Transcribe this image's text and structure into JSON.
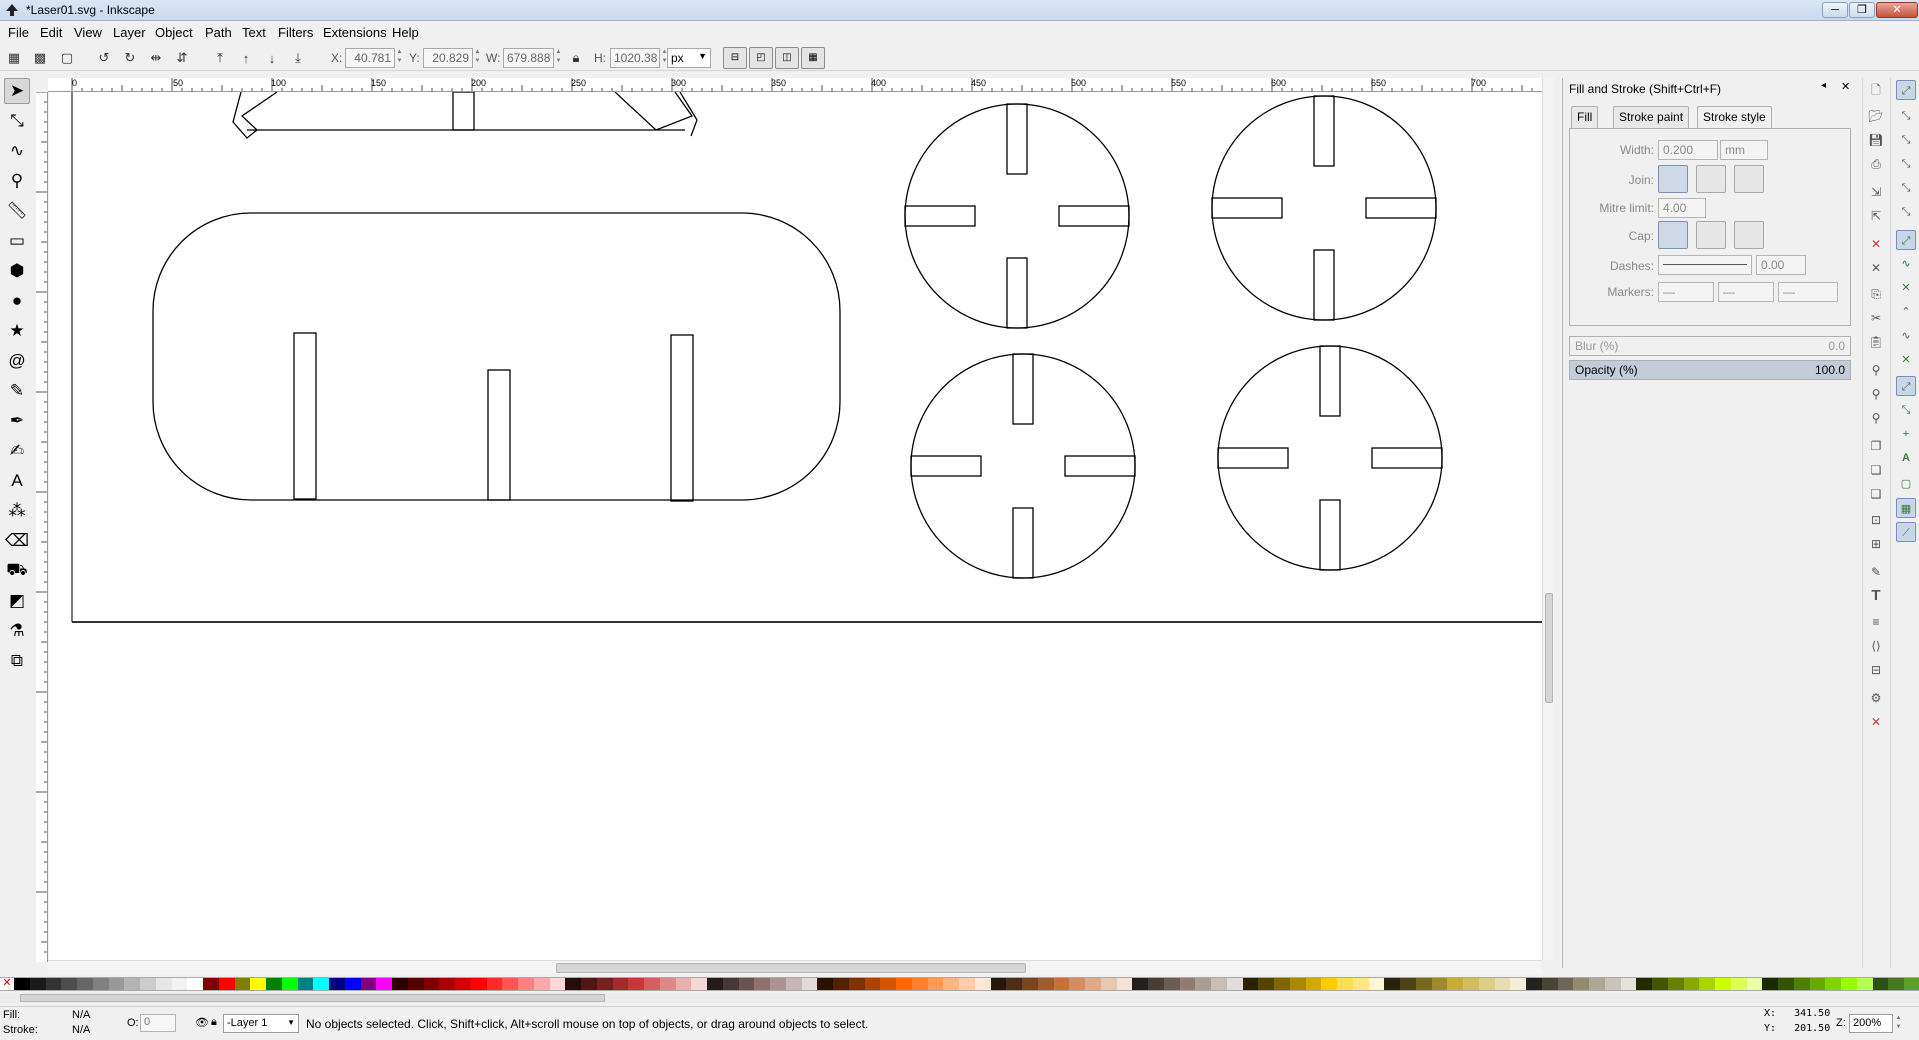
{
  "window": {
    "title": "*Laser01.svg - Inkscape",
    "buttons": {
      "minimize": "─",
      "maximize": "❐",
      "close": "✕"
    }
  },
  "menu": [
    "File",
    "Edit",
    "View",
    "Layer",
    "Object",
    "Path",
    "Text",
    "Filters",
    "Extensions",
    "Help"
  ],
  "controls": {
    "x_label": "X:",
    "x_value": "40.781",
    "y_label": "Y:",
    "y_value": "20.829",
    "w_label": "W:",
    "w_value": "679.888",
    "h_label": "H:",
    "h_value": "1020.38",
    "unit": "px"
  },
  "ruler": {
    "h_labels": [
      "0",
      "50",
      "100",
      "150",
      "200",
      "250",
      "300",
      "350",
      "400",
      "450",
      "500",
      "550",
      "600",
      "650",
      "700"
    ]
  },
  "dock": {
    "title": "Fill and Stroke (Shift+Ctrl+F)",
    "tabs": [
      "Fill",
      "Stroke paint",
      "Stroke style"
    ],
    "active_tab": "Stroke style",
    "width_label": "Width:",
    "width_value": "0.200",
    "width_unit": "mm",
    "join_label": "Join:",
    "mitre_label": "Mitre limit:",
    "mitre_value": "4.00",
    "cap_label": "Cap:",
    "dashes_label": "Dashes:",
    "dashes_value": "0.00",
    "markers_label": "Markers:",
    "blur_label": "Blur (%)",
    "blur_value": "0.0",
    "opacity_label": "Opacity (%)",
    "opacity_value": "100.0"
  },
  "status": {
    "fill_label": "Fill:",
    "fill_value": "N/A",
    "stroke_label": "Stroke:",
    "stroke_value": "N/A",
    "opacity_label": "O:",
    "opacity_value": "0",
    "layer": "-Layer 1",
    "message": "No objects selected. Click, Shift+click, Alt+scroll mouse on top of objects, or drag around objects to select.",
    "coord_x": "X:   341.50",
    "coord_y": "Y:   201.50",
    "zoom_label": "Z:",
    "zoom_value": "200%"
  },
  "colors": {
    "accent": "#7391bb",
    "palette": [
      "#000000",
      "#1a1a1a",
      "#333333",
      "#4d4d4d",
      "#666666",
      "#808080",
      "#999999",
      "#b3b3b3",
      "#cccccc",
      "#e6e6e6",
      "#f2f2f2",
      "#ffffff",
      "#800000",
      "#ff0000",
      "#808000",
      "#ffff00",
      "#008000",
      "#00ff00",
      "#008080",
      "#00ffff",
      "#000080",
      "#0000ff",
      "#800080",
      "#ff00ff",
      "#2b0000",
      "#550000",
      "#800000",
      "#aa0000",
      "#d40000",
      "#ff0000",
      "#ff2a2a",
      "#ff5555",
      "#ff8080",
      "#ffaaaa",
      "#ffd5d5",
      "#280b0b",
      "#501616",
      "#782121",
      "#a02c2c",
      "#c83737",
      "#d35f5f",
      "#de8787",
      "#e9afaf",
      "#f4d7d7",
      "#241c1c",
      "#483737",
      "#6c5353",
      "#916f6f",
      "#ac9393",
      "#c8b7b7",
      "#e3dbdb",
      "#2b1100",
      "#552200",
      "#803300",
      "#aa4400",
      "#d45500",
      "#ff6600",
      "#ff7f2a",
      "#ff9955",
      "#ffb380",
      "#ffccaa",
      "#ffe6d5",
      "#28170b",
      "#502d16",
      "#784421",
      "#a05a2c",
      "#c87137",
      "#d38d5f",
      "#deaa87",
      "#e9c6af",
      "#f4e3d7",
      "#241f1c",
      "#483e37",
      "#6c5d53",
      "#917c6f",
      "#ac9d93",
      "#c8beb7",
      "#e3dedb",
      "#2b2200",
      "#554400",
      "#806600",
      "#aa8800",
      "#d4aa00",
      "#ffcc00",
      "#ffdd55",
      "#ffe680",
      "#fff6d5",
      "#28220b",
      "#504416",
      "#786721",
      "#a0892c",
      "#c8ab37",
      "#d3bc5f",
      "#decd87",
      "#e9ddaf",
      "#f4eed7",
      "#24221c",
      "#484537",
      "#6c6753",
      "#918a6f",
      "#aca793",
      "#c8c4b7",
      "#e3e2db",
      "#222b00",
      "#445500",
      "#668000",
      "#88aa00",
      "#aad400",
      "#ccff00",
      "#ddff55",
      "#eeffaa",
      "#1a2b00",
      "#335500",
      "#4d8000",
      "#66aa00",
      "#80d400",
      "#99ff00",
      "#b3ff55",
      "#2d5016",
      "#447821",
      "#5aa02c"
    ]
  }
}
